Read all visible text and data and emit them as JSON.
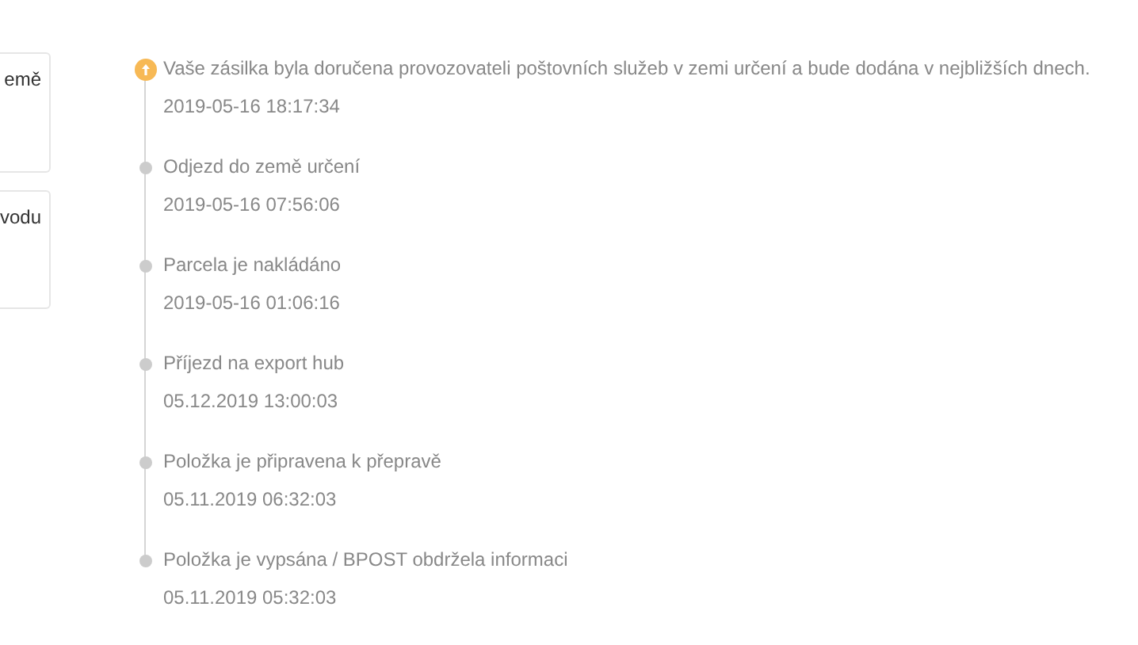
{
  "side_cards": [
    {
      "text": "emě"
    },
    {
      "text": "vodu"
    }
  ],
  "events": [
    {
      "kind": "current",
      "status": "Vaše zásilka byla doručena provozovateli poštovních služeb v zemi určení a bude dodána v nejbližších dnech.",
      "time": "2019-05-16 18:17:34"
    },
    {
      "kind": "past",
      "status": "Odjezd do země určení",
      "time": "2019-05-16 07:56:06"
    },
    {
      "kind": "past",
      "status": "Parcela je nakládáno",
      "time": "2019-05-16 01:06:16"
    },
    {
      "kind": "past",
      "status": "Příjezd na export hub",
      "time": "05.12.2019 13:00:03"
    },
    {
      "kind": "past",
      "status": "Položka je připravena k přepravě",
      "time": "05.11.2019 06:32:03"
    },
    {
      "kind": "past",
      "status": "Položka je vypsána / BPOST obdržela informaci",
      "time": "05.11.2019 05:32:03"
    }
  ]
}
